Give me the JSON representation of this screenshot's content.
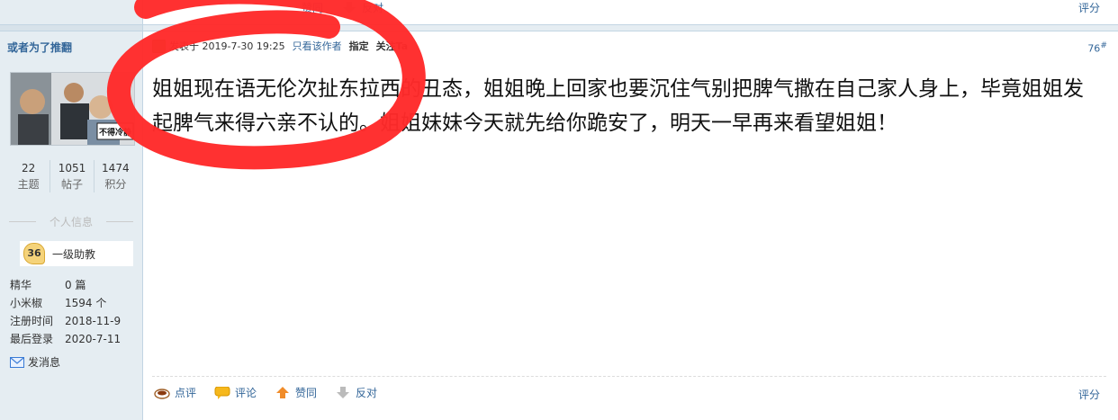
{
  "top": {
    "upvote_label": "赞同",
    "downvote_label": "反对",
    "rate_label": "评分"
  },
  "author": {
    "name": "或者为了推翻",
    "avatar_caption": "不得冷静",
    "stats": [
      {
        "value": "22",
        "label": "主题"
      },
      {
        "value": "1051",
        "label": "帖子"
      },
      {
        "value": "1474",
        "label": "积分"
      }
    ],
    "section_title": "个人信息",
    "rank_level": "36",
    "rank_name": "一级助教",
    "fields": [
      {
        "key": "精华",
        "value": "0 篇"
      },
      {
        "key": "小米椒",
        "value": "1594 个"
      },
      {
        "key": "注册时间",
        "value": "2018-11-9"
      },
      {
        "key": "最后登录",
        "value": "2020-7-11"
      }
    ],
    "message_label": "发消息"
  },
  "post": {
    "posted_at": "发表于 2019-7-30 19:25",
    "only_author": "只看该作者",
    "label_3": "指定",
    "follow": "关注Ta",
    "floor": "76",
    "floor_suffix": "#",
    "content": "姐姐现在语无伦次扯东拉西的丑态，姐姐晚上回家也要沉住气别把脾气撒在自己家人身上，毕竟姐姐发起脾气来得六亲不认的。姐姐妹妹今天就先给你跪安了，明天一早再来看望姐姐！",
    "actions": [
      {
        "label": "点评",
        "icon": "comment-cup-icon"
      },
      {
        "label": "评论",
        "icon": "speech-bubble-icon"
      },
      {
        "label": "赞同",
        "icon": "arrow-up-icon"
      },
      {
        "label": "反对",
        "icon": "arrow-down-icon"
      }
    ],
    "rate_label": "评分"
  },
  "colors": {
    "link": "#336699",
    "sidebar_bg": "#e5edf2",
    "annotation_red": "#ff2a2a"
  }
}
